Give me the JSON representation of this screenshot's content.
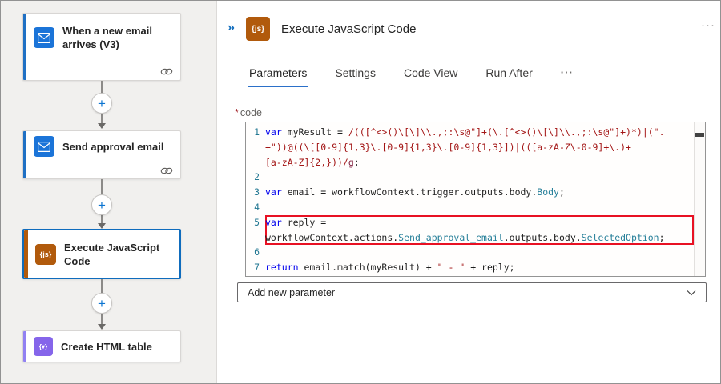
{
  "left_panel": {
    "steps": [
      {
        "title": "When a new email arrives (V3)",
        "connector": "office365-outlook"
      },
      {
        "title": "Send approval email",
        "connector": "office365-outlook"
      },
      {
        "title": "Execute JavaScript Code",
        "connector": "inline-code",
        "selected": true,
        "icon_glyph": "{js}"
      },
      {
        "title": "Create HTML table",
        "connector": "data-operation",
        "icon_glyph": "{▾}"
      }
    ],
    "plus_glyph": "+"
  },
  "panel": {
    "collapse_glyph": "»",
    "icon_glyph": "{js}",
    "title": "Execute JavaScript Code",
    "more_glyph": "···",
    "tabs": [
      {
        "label": "Parameters",
        "active": true
      },
      {
        "label": "Settings"
      },
      {
        "label": "Code View"
      },
      {
        "label": "Run After"
      },
      {
        "label": "···",
        "overflow": true
      }
    ]
  },
  "code_field": {
    "required_marker": "*",
    "label": "code"
  },
  "code": {
    "rows": [
      {
        "num": "1",
        "seg": [
          {
            "t": "var",
            "c": "kw"
          },
          {
            "t": " myResult = ",
            "c": "plain"
          },
          {
            "t": "/(([^<>()\\[\\]\\\\.,;:\\s@\"]+(\\.[^<>()\\[\\]\\\\.,;:\\s@\"]+)*)|(\".",
            "c": "rgx"
          }
        ]
      },
      {
        "num": "",
        "seg": [
          {
            "t": "+\"))@((\\[[0-9]{1,3}\\.[0-9]{1,3}\\.[0-9]{1,3}])|(([a-zA-Z\\-0-9]+\\.)+",
            "c": "rgx"
          }
        ]
      },
      {
        "num": "",
        "seg": [
          {
            "t": "[a-zA-Z]{2,}))/",
            "c": "rgx"
          },
          {
            "t": "g",
            "c": "flag"
          },
          {
            "t": ";",
            "c": "plain"
          }
        ]
      },
      {
        "num": "2",
        "seg": []
      },
      {
        "num": "3",
        "seg": [
          {
            "t": "var",
            "c": "kw"
          },
          {
            "t": " email = workflowContext.trigger.outputs.body.",
            "c": "plain"
          },
          {
            "t": "Body",
            "c": "prop"
          },
          {
            "t": ";",
            "c": "plain"
          }
        ]
      },
      {
        "num": "4",
        "seg": []
      },
      {
        "num": "5",
        "hl": "top",
        "seg": [
          {
            "t": "var",
            "c": "kw"
          },
          {
            "t": " reply =",
            "c": "plain"
          }
        ]
      },
      {
        "num": "",
        "hl": "bottom",
        "seg": [
          {
            "t": "workflowContext.actions.",
            "c": "plain"
          },
          {
            "t": "Send_approval_email",
            "c": "prop"
          },
          {
            "t": ".outputs.body.",
            "c": "plain"
          },
          {
            "t": "SelectedOption",
            "c": "prop"
          },
          {
            "t": ";",
            "c": "plain"
          }
        ]
      },
      {
        "num": "6",
        "seg": []
      },
      {
        "num": "7",
        "seg": [
          {
            "t": "return",
            "c": "kw"
          },
          {
            "t": " email.match(myResult) + ",
            "c": "plain"
          },
          {
            "t": "\" - \"",
            "c": "str"
          },
          {
            "t": " + reply;",
            "c": "plain"
          }
        ]
      }
    ]
  },
  "add_parameter": {
    "label": "Add new parameter"
  },
  "colors": {
    "accent_blue": "#1f70c4",
    "selected_border": "#0f6cbd",
    "js_orange": "#b15a0c",
    "data_op_purple": "#8565ea",
    "data_op_accent": "#9181f2",
    "highlight_red": "#e81123",
    "keyword_blue": "#0000ee",
    "regex_maroon": "#a31515",
    "property_teal": "#267f99",
    "line_number": "#237893"
  }
}
